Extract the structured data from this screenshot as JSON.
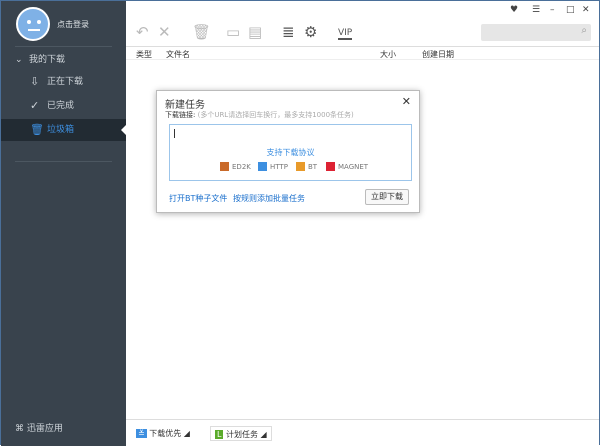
{
  "sidebar": {
    "login": "点击登录",
    "group": "我的下载",
    "items": [
      {
        "label": "正在下载",
        "icon": "download-icon"
      },
      {
        "label": "已完成",
        "icon": "check-circle-icon"
      },
      {
        "label": "垃圾箱",
        "icon": "trash-icon"
      }
    ],
    "apps": "迅雷应用"
  },
  "toolbar": {
    "vip": "VIP"
  },
  "columns": {
    "type": "类型",
    "name": "文件名",
    "size": "大小",
    "date": "创建日期"
  },
  "dialog": {
    "title": "新建任务",
    "label": "下载链接:",
    "hint": "(多个URL请选择回车换行，最多支持1000条任务)",
    "supported": "支持下载协议",
    "protocols": [
      "ED2K",
      "HTTP",
      "BT",
      "MAGNET"
    ],
    "link_bt": "打开BT种子文件",
    "link_batch": "按规则添加批量任务",
    "download": "立即下载"
  },
  "status": {
    "priority": "下载优先",
    "schedule": "计划任务"
  },
  "colors": {
    "sidebar": "#39434d",
    "selected": "#222b33",
    "accent": "#3d8fe0"
  }
}
